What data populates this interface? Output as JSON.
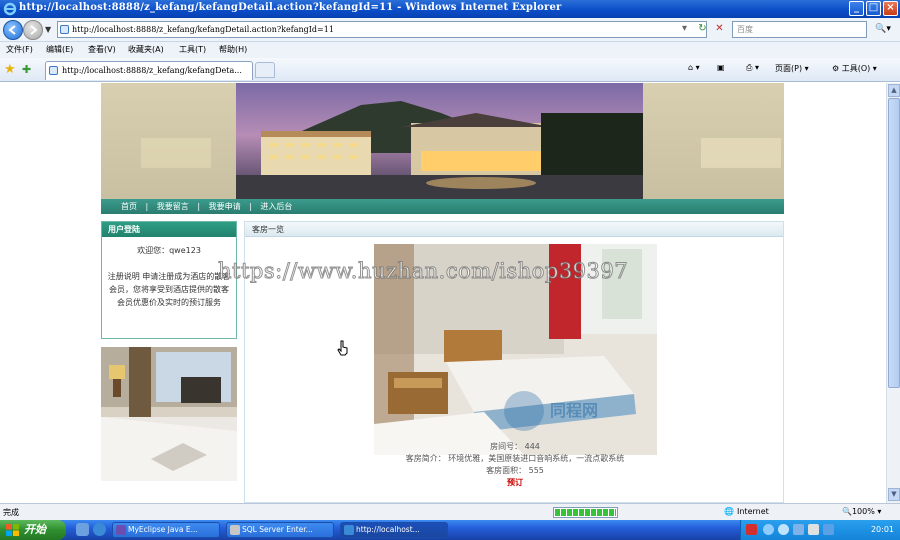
{
  "window": {
    "title": "http://localhost:8888/z_kefang/kefangDetail.action?kefangId=11 - Windows Internet Explorer",
    "minimize": "_",
    "maximize": "□",
    "close": "×"
  },
  "address_bar": {
    "url": "http://localhost:8888/z_kefang/kefangDetail.action?kefangId=11",
    "search_placeholder": "百度",
    "refresh": "↻",
    "stop": "✕"
  },
  "menu": [
    "文件(F)",
    "编辑(E)",
    "查看(V)",
    "收藏夹(A)",
    "工具(T)",
    "帮助(H)"
  ],
  "tab": {
    "label": "http://localhost:8888/z_kefang/kefangDeta..."
  },
  "command_bar": {
    "page": "页面(P)",
    "tools": "工具(O)"
  },
  "site": {
    "nav": [
      "首页",
      "|",
      "我要留言",
      "|",
      "我要申请",
      "|",
      "进入后台"
    ],
    "login_box": {
      "title": "用户登陆",
      "welcome": "欢迎您：qwe123",
      "notice": "注册说明 申请注册成为酒店的散客会员，您将享受到酒店提供的散客会员优惠价及实时的预订服务"
    },
    "main": {
      "heading": "客房一览",
      "room_number_label": "房间号：",
      "room_number": "444",
      "intro_label": "客房简介：",
      "intro": "环境优雅，美国原装进口音响系统，一流点歌系统",
      "area_label": "客房面积：",
      "area": "555",
      "book": "预订"
    },
    "photo_logo": "同程网"
  },
  "watermark": "https://www.huzhan.com/ishop39397",
  "status_bar": {
    "text": "完成",
    "zone": "Internet",
    "zoom": "100%",
    "progress": 1.0
  },
  "taskbar": {
    "start": "开始",
    "tasks": [
      "MyEclipse Java E...",
      "SQL Server Enter...",
      "http://localhost..."
    ],
    "active_task": 2,
    "clock": "20:01"
  },
  "colors": {
    "nav_teal": "#2a7d70",
    "box_head": "#21826d",
    "book_red": "#cc0000",
    "title_blue": "#0a4bc7"
  }
}
